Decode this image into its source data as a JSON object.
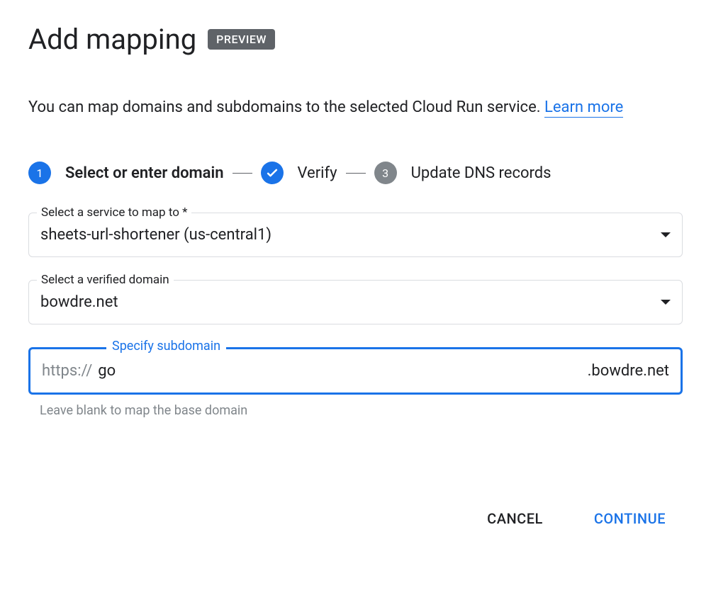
{
  "header": {
    "title": "Add mapping",
    "badge": "PREVIEW"
  },
  "description": {
    "text": "You can map domains and subdomains to the selected Cloud Run service. ",
    "link": "Learn more"
  },
  "stepper": {
    "step1": {
      "number": "1",
      "label": "Select or enter domain"
    },
    "step2": {
      "label": "Verify"
    },
    "step3": {
      "number": "3",
      "label": "Update DNS records"
    }
  },
  "fields": {
    "service": {
      "label": "Select a service to map to *",
      "value": "sheets-url-shortener (us-central1)"
    },
    "domain": {
      "label": "Select a verified domain",
      "value": "bowdre.net"
    },
    "subdomain": {
      "label": "Specify subdomain",
      "prefix": "https://",
      "value": "go",
      "suffix": ".bowdre.net",
      "helper": "Leave blank to map the base domain"
    }
  },
  "buttons": {
    "cancel": "CANCEL",
    "continue": "CONTINUE"
  }
}
